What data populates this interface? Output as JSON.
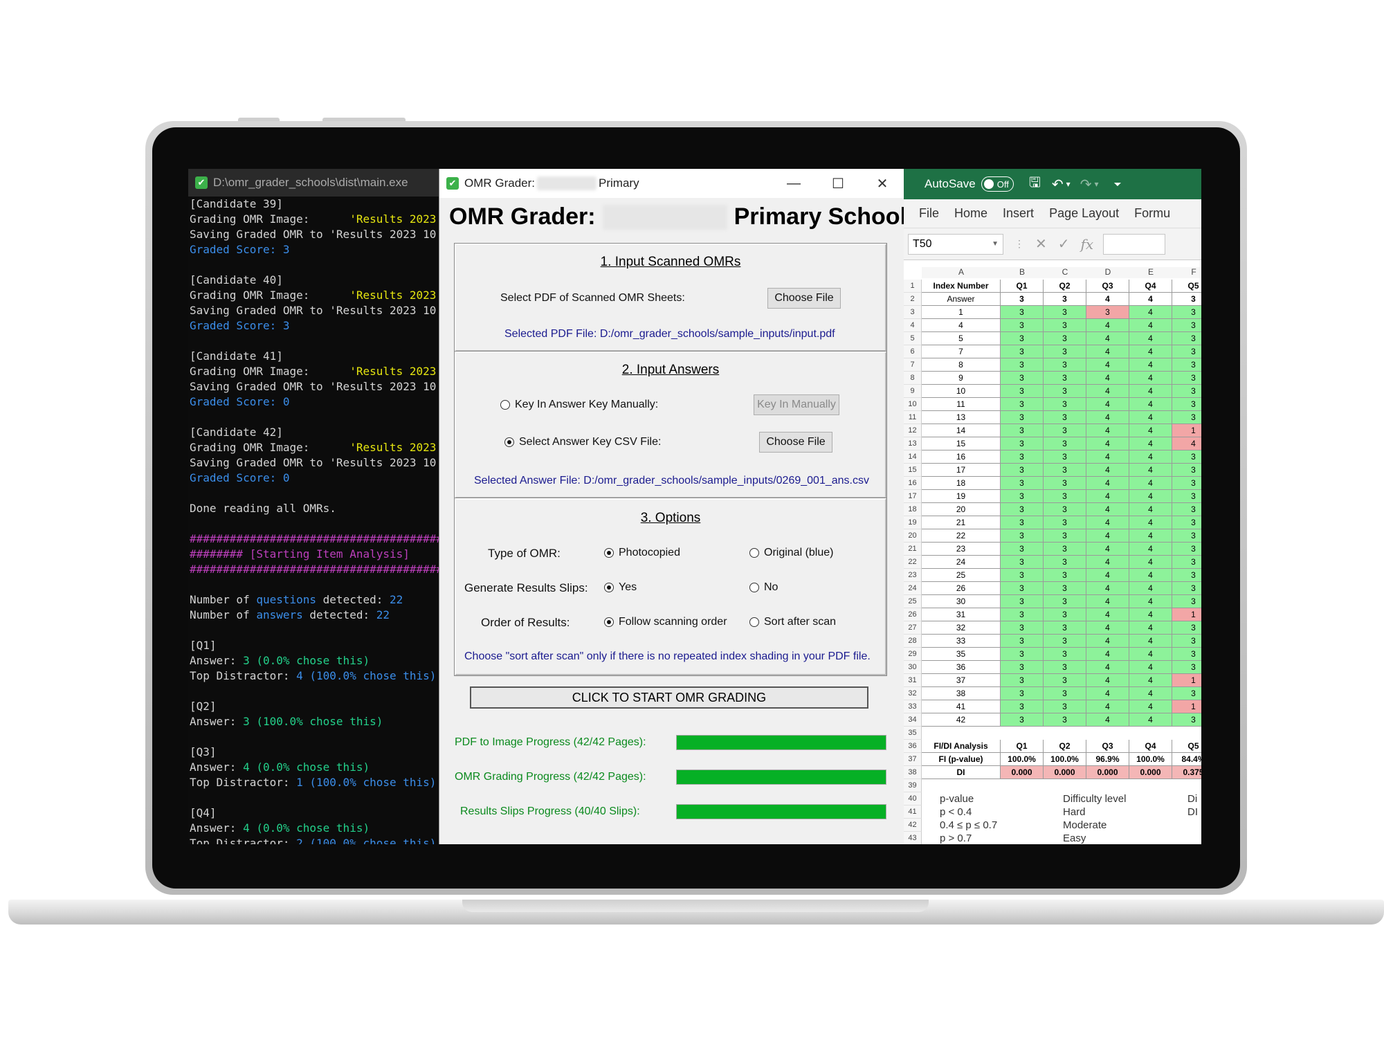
{
  "terminal": {
    "title": "D:\\omr_grader_schools\\dist\\main.exe",
    "lines": [
      [
        [
          "[Candidate 39]",
          ""
        ]
      ],
      [
        [
          "Grading OMR Image:      ",
          ""
        ],
        [
          "'Results 2023",
          "c-yel"
        ]
      ],
      [
        [
          "Saving Graded OMR to 'Results 2023 10",
          ""
        ]
      ],
      [
        [
          "Graded Score: 3",
          "c-blu"
        ]
      ],
      [
        [
          "",
          ""
        ]
      ],
      [
        [
          "[Candidate 40]",
          ""
        ]
      ],
      [
        [
          "Grading OMR Image:      ",
          ""
        ],
        [
          "'Results 2023",
          "c-yel"
        ]
      ],
      [
        [
          "Saving Graded OMR to 'Results 2023 10",
          ""
        ]
      ],
      [
        [
          "Graded Score: 3",
          "c-blu"
        ]
      ],
      [
        [
          "",
          ""
        ]
      ],
      [
        [
          "[Candidate 41]",
          ""
        ]
      ],
      [
        [
          "Grading OMR Image:      ",
          ""
        ],
        [
          "'Results 2023",
          "c-yel"
        ]
      ],
      [
        [
          "Saving Graded OMR to 'Results 2023 10",
          ""
        ]
      ],
      [
        [
          "Graded Score: 0",
          "c-blu"
        ]
      ],
      [
        [
          "",
          ""
        ]
      ],
      [
        [
          "[Candidate 42]",
          ""
        ]
      ],
      [
        [
          "Grading OMR Image:      ",
          ""
        ],
        [
          "'Results 2023",
          "c-yel"
        ]
      ],
      [
        [
          "Saving Graded OMR to 'Results 2023 10",
          ""
        ]
      ],
      [
        [
          "Graded Score: 0",
          "c-blu"
        ]
      ],
      [
        [
          "",
          ""
        ]
      ],
      [
        [
          "Done reading all OMRs.",
          ""
        ]
      ],
      [
        [
          "",
          ""
        ]
      ],
      [
        [
          "########################################",
          "c-mag"
        ]
      ],
      [
        [
          "######## [Starting Item Analysis]",
          "c-mag"
        ]
      ],
      [
        [
          "########################################",
          "c-mag"
        ]
      ],
      [
        [
          "",
          ""
        ]
      ],
      [
        [
          "Number of ",
          ""
        ],
        [
          "questions",
          "c-blu"
        ],
        [
          " detected: ",
          ""
        ],
        [
          "22",
          "c-blu"
        ]
      ],
      [
        [
          "Number of ",
          ""
        ],
        [
          "answers",
          "c-blu"
        ],
        [
          " detected: ",
          ""
        ],
        [
          "22",
          "c-blu"
        ]
      ],
      [
        [
          "",
          ""
        ]
      ],
      [
        [
          "[Q1]",
          ""
        ]
      ],
      [
        [
          "Answer: ",
          ""
        ],
        [
          "3 (0.0% chose this)",
          "c-grn"
        ]
      ],
      [
        [
          "Top Distractor: ",
          ""
        ],
        [
          "4 (100.0% chose this)",
          "c-blu"
        ]
      ],
      [
        [
          "",
          ""
        ]
      ],
      [
        [
          "[Q2]",
          ""
        ]
      ],
      [
        [
          "Answer: ",
          ""
        ],
        [
          "3 (100.0% chose this)",
          "c-grn"
        ]
      ],
      [
        [
          "",
          ""
        ]
      ],
      [
        [
          "[Q3]",
          ""
        ]
      ],
      [
        [
          "Answer: ",
          ""
        ],
        [
          "4 (0.0% chose this)",
          "c-grn"
        ]
      ],
      [
        [
          "Top Distractor: ",
          ""
        ],
        [
          "1 (100.0% chose this)",
          "c-blu"
        ]
      ],
      [
        [
          "",
          ""
        ]
      ],
      [
        [
          "[Q4]",
          ""
        ]
      ],
      [
        [
          "Answer: ",
          ""
        ],
        [
          "4 (0.0% chose this)",
          "c-grn"
        ]
      ],
      [
        [
          "Top Distractor: ",
          ""
        ],
        [
          "2 (100.0% chose this)",
          "c-blu"
        ]
      ]
    ]
  },
  "omr": {
    "window_title_prefix": "OMR Grader:",
    "window_title_suffix": "Primary",
    "heading_prefix": "OMR Grader:",
    "heading_suffix": "Primary School",
    "section1": {
      "title": "1. Input Scanned OMRs",
      "select_label": "Select PDF of Scanned OMR Sheets:",
      "choose_file": "Choose File",
      "selected": "Selected PDF File: D:/omr_grader_schools/sample_inputs/input.pdf"
    },
    "section2": {
      "title": "2. Input Answers",
      "manual_label": "Key In Answer Key Manually:",
      "manual_button": "Key In Manually",
      "csv_label": "Select Answer Key CSV File:",
      "choose_file": "Choose File",
      "selected": "Selected Answer File: D:/omr_grader_schools/sample_inputs/0269_001_ans.csv",
      "selected_option": "csv"
    },
    "section3": {
      "title": "3. Options",
      "type_label": "Type of OMR:",
      "type_opt1": "Photocopied",
      "type_opt2": "Original (blue)",
      "slips_label": "Generate Results Slips:",
      "slips_opt1": "Yes",
      "slips_opt2": "No",
      "order_label": "Order of Results:",
      "order_opt1": "Follow scanning order",
      "order_opt2": "Sort after scan",
      "note": "Choose \"sort after scan\" only if there is no repeated index shading in your PDF file."
    },
    "start_button": "CLICK TO START OMR GRADING",
    "progress": [
      {
        "label": "PDF to Image Progress (42/42 Pages):",
        "fraction": 1.0
      },
      {
        "label": "OMR Grading Progress (42/42 Pages):",
        "fraction": 1.0
      },
      {
        "label": "Results Slips Progress (40/40 Slips):",
        "fraction": 1.0
      }
    ]
  },
  "excel": {
    "autosave": "AutoSave",
    "toggle": "Off",
    "menu": [
      "File",
      "Home",
      "Insert",
      "Page Layout",
      "Formu"
    ],
    "namebox": "T50",
    "columns": [
      "A",
      "B",
      "C",
      "D",
      "E",
      "F"
    ],
    "header_row": [
      "Index Number",
      "Q1",
      "Q2",
      "Q3",
      "Q4",
      "Q5"
    ],
    "answer_row": [
      "Answer",
      "3",
      "3",
      "4",
      "4",
      "3"
    ],
    "students": [
      [
        "1",
        "3",
        "3",
        "3",
        "4",
        "3"
      ],
      [
        "4",
        "3",
        "3",
        "4",
        "4",
        "3"
      ],
      [
        "5",
        "3",
        "3",
        "4",
        "4",
        "3"
      ],
      [
        "7",
        "3",
        "3",
        "4",
        "4",
        "3"
      ],
      [
        "8",
        "3",
        "3",
        "4",
        "4",
        "3"
      ],
      [
        "9",
        "3",
        "3",
        "4",
        "4",
        "3"
      ],
      [
        "10",
        "3",
        "3",
        "4",
        "4",
        "3"
      ],
      [
        "11",
        "3",
        "3",
        "4",
        "4",
        "3"
      ],
      [
        "13",
        "3",
        "3",
        "4",
        "4",
        "3"
      ],
      [
        "14",
        "3",
        "3",
        "4",
        "4",
        "1"
      ],
      [
        "15",
        "3",
        "3",
        "4",
        "4",
        "4"
      ],
      [
        "16",
        "3",
        "3",
        "4",
        "4",
        "3"
      ],
      [
        "17",
        "3",
        "3",
        "4",
        "4",
        "3"
      ],
      [
        "18",
        "3",
        "3",
        "4",
        "4",
        "3"
      ],
      [
        "19",
        "3",
        "3",
        "4",
        "4",
        "3"
      ],
      [
        "20",
        "3",
        "3",
        "4",
        "4",
        "3"
      ],
      [
        "21",
        "3",
        "3",
        "4",
        "4",
        "3"
      ],
      [
        "22",
        "3",
        "3",
        "4",
        "4",
        "3"
      ],
      [
        "23",
        "3",
        "3",
        "4",
        "4",
        "3"
      ],
      [
        "24",
        "3",
        "3",
        "4",
        "4",
        "3"
      ],
      [
        "25",
        "3",
        "3",
        "4",
        "4",
        "3"
      ],
      [
        "26",
        "3",
        "3",
        "4",
        "4",
        "3"
      ],
      [
        "30",
        "3",
        "3",
        "4",
        "4",
        "3"
      ],
      [
        "31",
        "3",
        "3",
        "4",
        "4",
        "1"
      ],
      [
        "32",
        "3",
        "3",
        "4",
        "4",
        "3"
      ],
      [
        "33",
        "3",
        "3",
        "4",
        "4",
        "3"
      ],
      [
        "35",
        "3",
        "3",
        "4",
        "4",
        "3"
      ],
      [
        "36",
        "3",
        "3",
        "4",
        "4",
        "3"
      ],
      [
        "37",
        "3",
        "3",
        "4",
        "4",
        "1"
      ],
      [
        "38",
        "3",
        "3",
        "4",
        "4",
        "3"
      ],
      [
        "41",
        "3",
        "3",
        "4",
        "4",
        "1"
      ],
      [
        "42",
        "3",
        "3",
        "4",
        "4",
        "3"
      ]
    ],
    "analysis_header": [
      "FI/DI Analysis",
      "Q1",
      "Q2",
      "Q3",
      "Q4",
      "Q5"
    ],
    "fi_row": [
      "FI (p-value)",
      "100.0%",
      "100.0%",
      "96.9%",
      "100.0%",
      "84.4%"
    ],
    "di_row": [
      "DI",
      "0.000",
      "0.000",
      "0.000",
      "0.000",
      "0.375"
    ],
    "legend": [
      [
        "p-value",
        "Difficulty level",
        "Di"
      ],
      [
        "p < 0.4",
        "Hard",
        "DI"
      ],
      [
        "0.4 ≤ p ≤ 0.7",
        "Moderate",
        ""
      ],
      [
        "p > 0.7",
        "Easy",
        ""
      ]
    ],
    "row_numbers": [
      "1",
      "2",
      "3",
      "4",
      "5",
      "6",
      "7",
      "8",
      "9",
      "10",
      "11",
      "12",
      "13",
      "14",
      "15",
      "16",
      "17",
      "18",
      "19",
      "20",
      "21",
      "22",
      "23",
      "24",
      "25",
      "26",
      "27",
      "28",
      "29",
      "30",
      "31",
      "32",
      "33",
      "34",
      "35",
      "36",
      "37",
      "38",
      "39",
      "40",
      "41",
      "42",
      "43"
    ]
  }
}
